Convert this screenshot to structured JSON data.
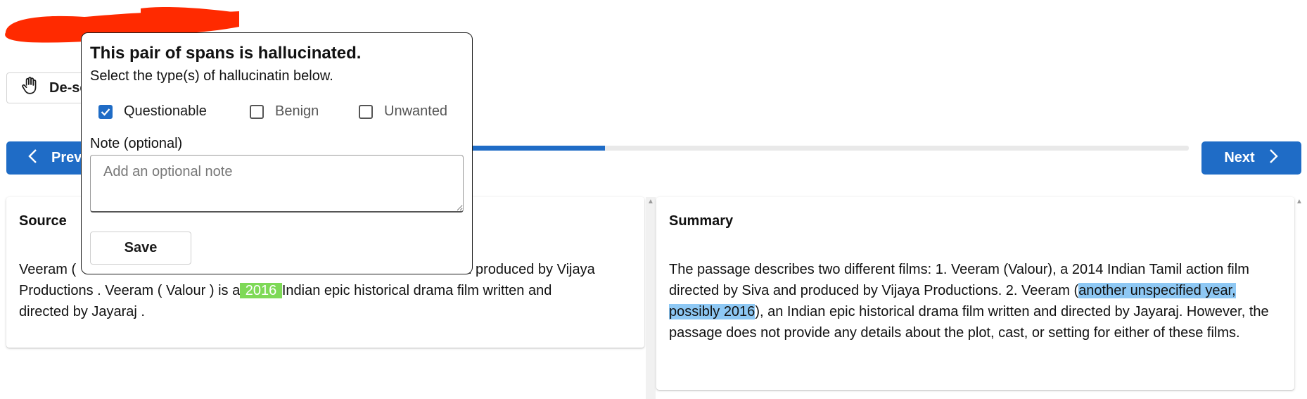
{
  "header": {
    "redacted_mark_color": "#ff2a00"
  },
  "toolbar": {
    "deselect_label": "De-se",
    "deselect_icon": "hand-icon"
  },
  "navigation": {
    "prev_label": "Prev",
    "next_label": "Next",
    "progress_fraction": 0.45,
    "accent_color": "#1f6cc6"
  },
  "source": {
    "heading": "Source",
    "text_visible_start": "Veeram (",
    "text_visible_after_popup": "nd produced by Vijaya",
    "line2_before": "Productions . Veeram ( Valour ) is a",
    "highlight": " 2016 ",
    "line2_after": "Indian epic historical drama film written and",
    "line3": "directed by Jayaraj ."
  },
  "summary": {
    "heading": "Summary",
    "text_before": "The passage describes two different films: 1. Veeram (Valour), a 2014 Indian Tamil action film directed by Siva and produced by Vijaya Productions. 2. Veeram (",
    "highlight": "another unspecified year, possibly 2016",
    "text_after": "), an Indian epic historical drama film written and directed by Jayaraj. However, the passage does not provide any details about the plot, cast, or setting for either of these films."
  },
  "popup": {
    "title": "This pair of spans is hallucinated.",
    "subtitle": "Select the type(s) of hallucinatin below.",
    "options": [
      {
        "label": "Questionable",
        "checked": true
      },
      {
        "label": "Benign",
        "checked": false
      },
      {
        "label": "Unwanted",
        "checked": false
      }
    ],
    "note_label": "Note (optional)",
    "note_placeholder": "Add an optional note",
    "note_value": "",
    "save_label": "Save"
  }
}
